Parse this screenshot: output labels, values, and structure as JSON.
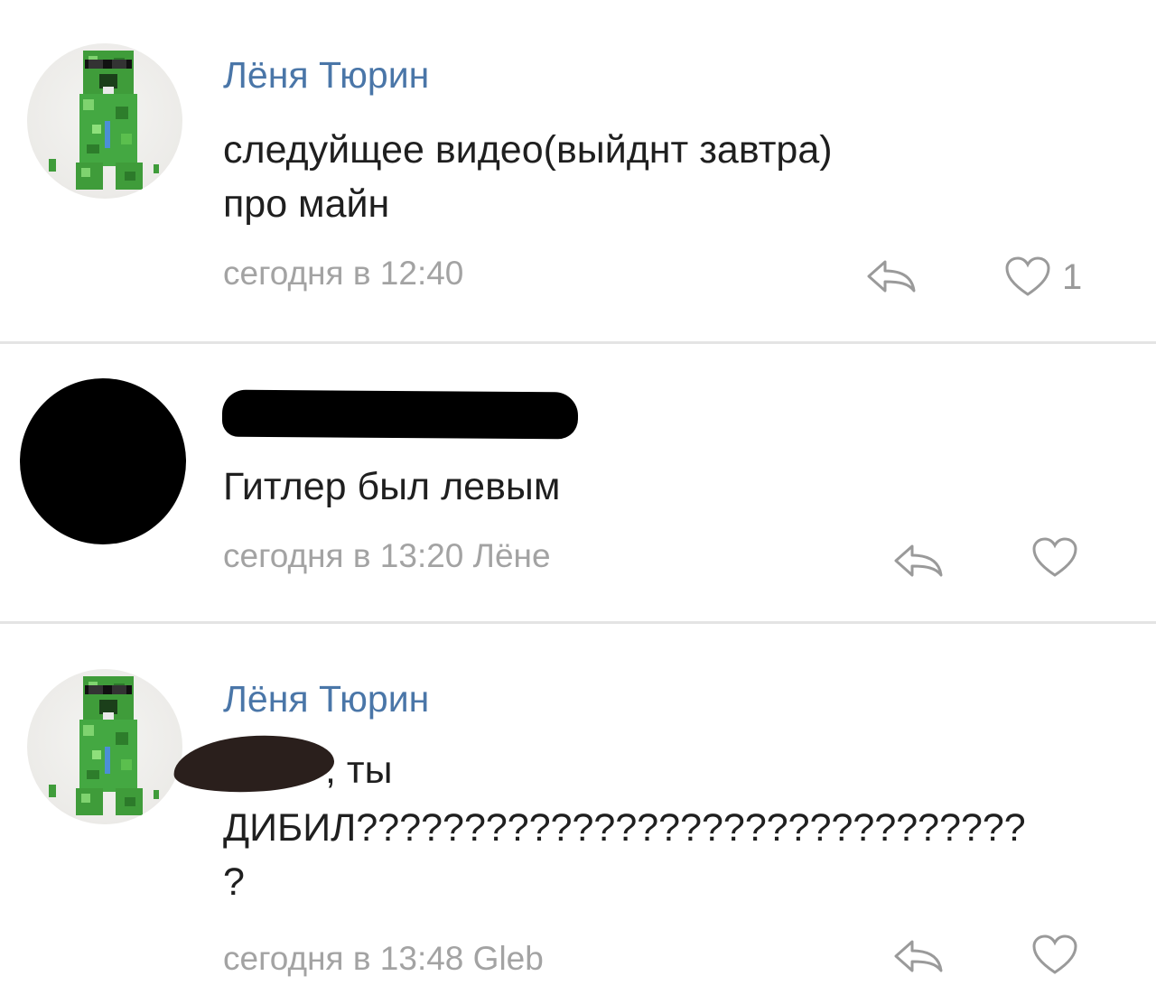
{
  "comments": [
    {
      "author": "Лёня Тюрин",
      "text": "следуйщее видео(выйднт завтра)\nпро майн",
      "timestamp": "сегодня в 12:40",
      "like_count": "1",
      "avatar_icon": "creeper-avatar-icon"
    },
    {
      "author": "",
      "text": "Гитлер был левым",
      "timestamp": "сегодня в 13:20 Лёне",
      "like_count": "",
      "avatar_icon": "redacted-avatar-icon"
    },
    {
      "author": "Лёня Тюрин",
      "text_suffix": ", ты",
      "text_rest": "ДИБИЛ???????????????????????????????\n?",
      "timestamp": "сегодня в 13:48 Gleb",
      "like_count": "",
      "avatar_icon": "creeper-avatar-icon"
    }
  ],
  "colors": {
    "author": "#4a76a8",
    "meta": "#a3a3a3",
    "text": "#1f1f1f",
    "creeper_green": "#4caf50"
  }
}
